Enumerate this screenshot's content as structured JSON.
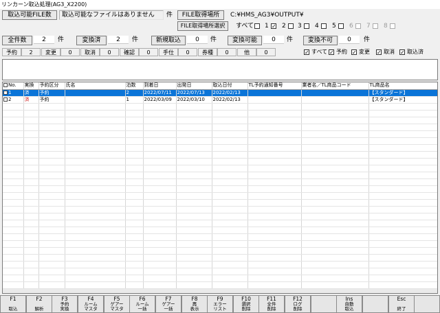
{
  "window": {
    "title": "リンカーン取込処理(AG3_X2200)"
  },
  "top": {
    "file_count_label": "取込可能FILE数",
    "file_status": "取込可能なファイルはありません",
    "file_unit": "件",
    "file_location_label": "FILE取得場所",
    "file_path": "C:¥HMS_AG3¥OUTPUT¥",
    "file_select_btn": "FILE取得場所選択",
    "filters": [
      {
        "label": "すべて",
        "checked": false,
        "disabled": false
      },
      {
        "label": "1",
        "checked": true,
        "disabled": false
      },
      {
        "label": "2",
        "checked": false,
        "disabled": false
      },
      {
        "label": "3",
        "checked": false,
        "disabled": false
      },
      {
        "label": "4",
        "checked": false,
        "disabled": false
      },
      {
        "label": "5",
        "checked": false,
        "disabled": false
      },
      {
        "label": "6",
        "checked": false,
        "disabled": true
      },
      {
        "label": "7",
        "checked": false,
        "disabled": true
      },
      {
        "label": "8",
        "checked": false,
        "disabled": true
      }
    ]
  },
  "counts": {
    "total_label": "全件数",
    "total_value": "2",
    "converted_label": "変換済",
    "converted_value": "2",
    "new_label": "新規取込",
    "new_value": "0",
    "convertible_label": "変換可能",
    "convertible_value": "0",
    "nonconvertible_label": "変換不可",
    "nonconvertible_value": "0",
    "unit": "件"
  },
  "summary": {
    "items": [
      {
        "label": "予約",
        "value": "2"
      },
      {
        "label": "変更",
        "value": "0"
      },
      {
        "label": "取消",
        "value": "0"
      },
      {
        "label": "確認",
        "value": "0"
      },
      {
        "label": "手仕",
        "value": "0"
      },
      {
        "label": "券種",
        "value": "0"
      },
      {
        "label": "他",
        "value": "0"
      }
    ],
    "checks": [
      {
        "label": "すべて",
        "checked": true
      },
      {
        "label": "予約",
        "checked": true
      },
      {
        "label": "変更",
        "checked": true
      },
      {
        "label": "取消",
        "checked": true
      },
      {
        "label": "取込済",
        "checked": true
      }
    ]
  },
  "grid": {
    "columns": [
      "No.",
      "実換",
      "予約区分",
      "氏名",
      "泊数",
      "到着日",
      "出発日",
      "取込日付",
      "TL予約通知番号",
      "業者名／TL商品コード",
      "TL商品名"
    ],
    "rows": [
      {
        "no": "1",
        "status": "済",
        "type": "予約",
        "name": "",
        "nights": "2",
        "arrival": "2022/07/11",
        "departure": "2022/07/13",
        "import_date": "2022/02/13",
        "tl_no": "",
        "vendor": "",
        "product": "【スタンダード】",
        "selected": true
      },
      {
        "no": "2",
        "status": "済",
        "type": "予約",
        "name": "",
        "nights": "1",
        "arrival": "2022/03/09",
        "departure": "2022/03/10",
        "import_date": "2022/02/13",
        "tl_no": "",
        "vendor": "",
        "product": "【スタンダード】",
        "selected": false
      }
    ]
  },
  "fkeys": [
    {
      "key": "F1",
      "label": "\n取込"
    },
    {
      "key": "F2",
      "label": "\n解析"
    },
    {
      "key": "F3",
      "label": "予約\n実換"
    },
    {
      "key": "F4",
      "label": "ルーム\nマスタ"
    },
    {
      "key": "F5",
      "label": "ゲアー\nマスタ"
    },
    {
      "key": "F6",
      "label": "ルーム\n一括"
    },
    {
      "key": "F7",
      "label": "ゲアー\n一括"
    },
    {
      "key": "F8",
      "label": "再\n表示"
    },
    {
      "key": "F9",
      "label": "エラー\nリスト"
    },
    {
      "key": "F10",
      "label": "選択\n削除"
    },
    {
      "key": "F11",
      "label": "全件\n削除"
    },
    {
      "key": "F12",
      "label": "ログ\n削除"
    },
    {
      "key": "",
      "label": ""
    },
    {
      "key": "Ins",
      "label": "自動\n取込"
    },
    {
      "key": "",
      "label": ""
    },
    {
      "key": "Esc",
      "label": "\n終了"
    },
    {
      "key": "",
      "label": ""
    }
  ]
}
